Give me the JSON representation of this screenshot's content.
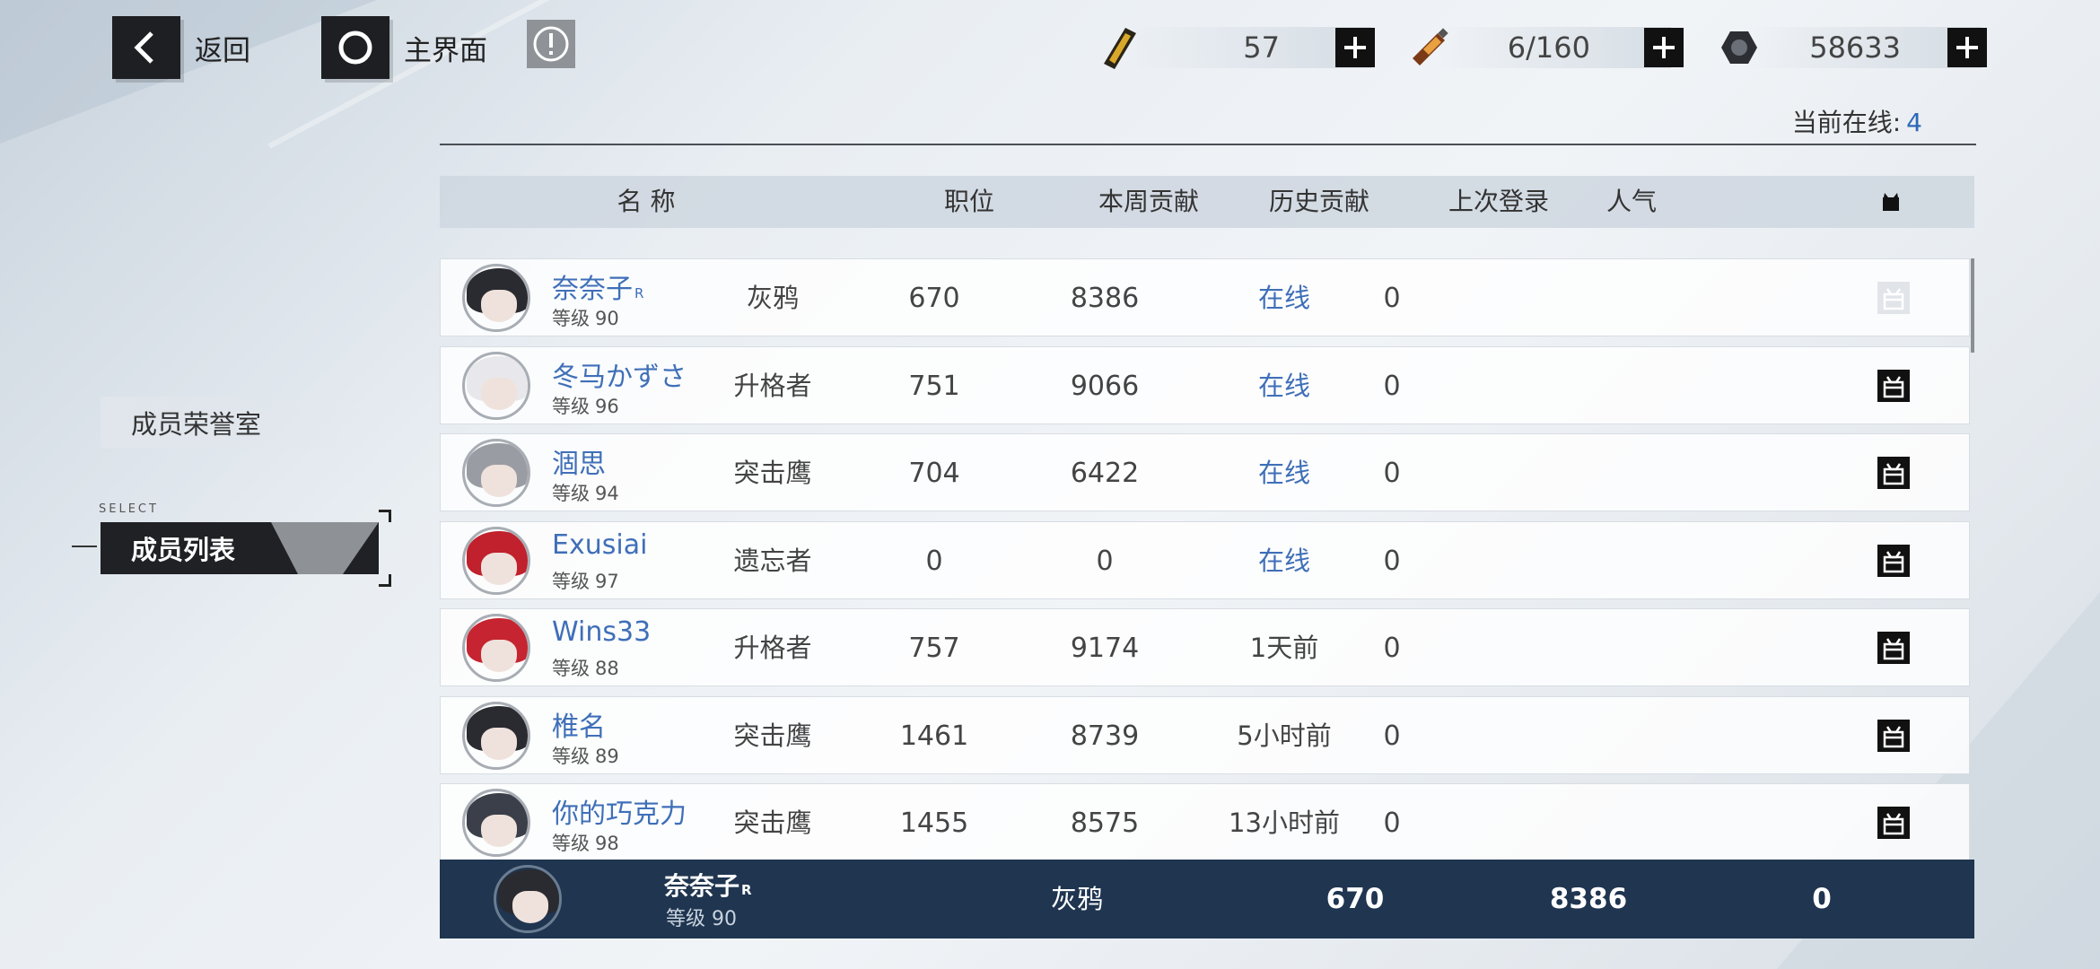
{
  "nav": {
    "back_label": "返回",
    "home_label": "主界面"
  },
  "resources": [
    {
      "icon": "ticket-icon",
      "value": "57"
    },
    {
      "icon": "battery-icon",
      "value": "6/160"
    },
    {
      "icon": "coin-icon",
      "value": "58633"
    }
  ],
  "online": {
    "label": "当前在线:",
    "count": "4"
  },
  "sidebar": {
    "items": [
      {
        "label": "成员荣誉室"
      },
      {
        "label": "成员列表",
        "select_tag": "SELECT"
      }
    ]
  },
  "table": {
    "headers": {
      "name": "名 称",
      "rank": "职位",
      "week": "本周贡献",
      "history": "历史贡献",
      "last_login": "上次登录",
      "popularity": "人气"
    },
    "level_prefix": "等级",
    "rows": [
      {
        "name": "奈奈子",
        "tag": "R",
        "level": "90",
        "rank": "灰鸦",
        "week": "670",
        "history": "8386",
        "last_login": "在线",
        "online": true,
        "popularity": "0",
        "gift_disabled": true,
        "hair": "#2a2b30"
      },
      {
        "name": "冬马かずさ",
        "tag": "",
        "level": "96",
        "rank": "升格者",
        "week": "751",
        "history": "9066",
        "last_login": "在线",
        "online": true,
        "popularity": "0",
        "gift_disabled": false,
        "hair": "#e8e8ec"
      },
      {
        "name": "涸思",
        "tag": "",
        "level": "94",
        "rank": "突击鹰",
        "week": "704",
        "history": "6422",
        "last_login": "在线",
        "online": true,
        "popularity": "0",
        "gift_disabled": false,
        "hair": "#9a9ca3"
      },
      {
        "name": "Exusiai",
        "tag": "",
        "level": "97",
        "rank": "遗忘者",
        "week": "0",
        "history": "0",
        "last_login": "在线",
        "online": true,
        "popularity": "0",
        "gift_disabled": false,
        "hair": "#c0212c"
      },
      {
        "name": "Wins33",
        "tag": "",
        "level": "88",
        "rank": "升格者",
        "week": "757",
        "history": "9174",
        "last_login": "1天前",
        "online": false,
        "popularity": "0",
        "gift_disabled": false,
        "hair": "#c62430"
      },
      {
        "name": "椎名",
        "tag": "",
        "level": "89",
        "rank": "突击鹰",
        "week": "1461",
        "history": "8739",
        "last_login": "5小时前",
        "online": false,
        "popularity": "0",
        "gift_disabled": false,
        "hair": "#2a2b30"
      },
      {
        "name": "你的巧克力",
        "tag": "",
        "level": "98",
        "rank": "突击鹰",
        "week": "1455",
        "history": "8575",
        "last_login": "13小时前",
        "online": false,
        "popularity": "0",
        "gift_disabled": false,
        "hair": "#3a3f4a"
      }
    ]
  },
  "self": {
    "name": "奈奈子",
    "tag": "R",
    "level_label": "等级 90",
    "rank": "灰鸦",
    "week": "670",
    "history": "8386",
    "popularity": "0"
  }
}
